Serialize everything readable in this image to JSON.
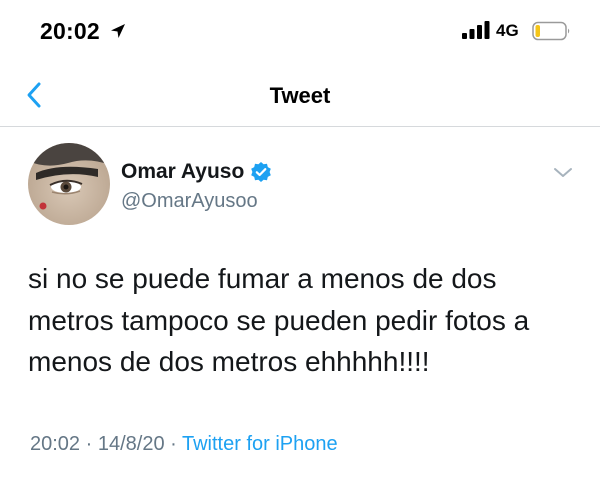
{
  "status_bar": {
    "time": "20:02",
    "network": "4G",
    "location_icon": "location-arrow-icon",
    "signal_icon": "signal-bars-icon",
    "battery_icon": "battery-icon",
    "battery_level": 0.15,
    "battery_color": "#f5c518"
  },
  "nav": {
    "back_icon": "chevron-left-icon",
    "title": "Tweet",
    "accent_color": "#1da1f2"
  },
  "tweet": {
    "author_name": "Omar Ayuso",
    "verified_icon": "verified-badge-icon",
    "handle": "@OmarAyusoo",
    "more_icon": "chevron-down-icon",
    "text": "si no se puede fumar a menos de dos metros tampoco se pueden pedir fotos a menos de dos metros ehhhhh!!!!",
    "time": "20:02",
    "sep1": " · ",
    "date": "14/8/20",
    "sep2": " · ",
    "source": "Twitter for iPhone"
  }
}
